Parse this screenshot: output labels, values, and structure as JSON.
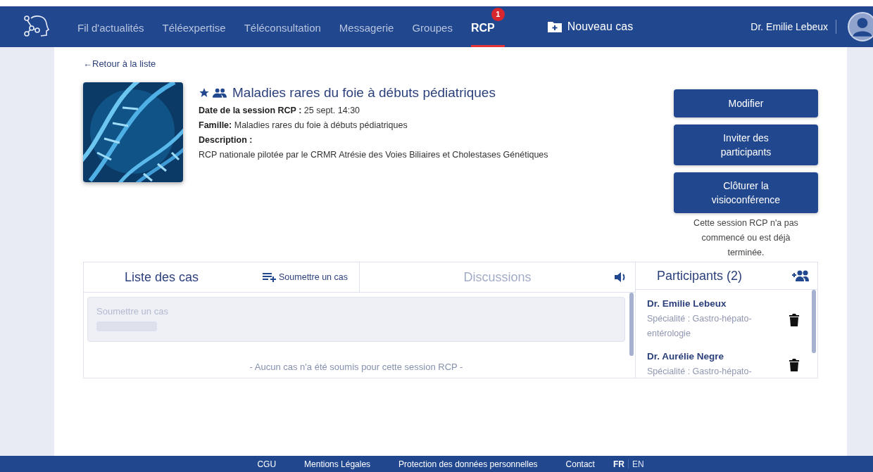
{
  "nav": {
    "items": [
      {
        "label": "Fil d'actualités",
        "selected": false
      },
      {
        "label": "Téléexpertise",
        "selected": false
      },
      {
        "label": "Téléconsultation",
        "selected": false
      },
      {
        "label": "Messagerie",
        "selected": false
      },
      {
        "label": "Groupes",
        "selected": false
      },
      {
        "label": "RCP",
        "selected": true,
        "badge": "1"
      }
    ],
    "new_case": "Nouveau cas",
    "user": "Dr. Emilie Lebeux"
  },
  "back_link": "←Retour à la liste",
  "session": {
    "favorite": true,
    "title": "Maladies rares du foie à débuts pédiatriques",
    "fields": [
      {
        "label": "Date de la session RCP :",
        "value": "25 sept. 14:30"
      },
      {
        "label": "Famille:",
        "value": "Maladies rares du foie à débuts pédiatriques"
      },
      {
        "label": "Description :"
      }
    ],
    "description": "RCP nationale pilotée par le CRMR Atrésie des Voies Biliaires et Cholestases Génétiques"
  },
  "actions": [
    "Modifier",
    "Inviter des participants",
    "Clôturer la visioconférence"
  ],
  "action_note": "Cette session RCP n'a pas commencé ou est déjà terminée.",
  "tabs": [
    {
      "label": "Liste des cas",
      "selected": true,
      "action": "Soumettre un cas"
    },
    {
      "label": "Discussions",
      "selected": false
    }
  ],
  "case_form": {
    "placeholder": "Soumettre un cas"
  },
  "empty_message": "- Aucun cas n'a été soumis pour cette session RCP -",
  "participants": {
    "title": "Participants (2)",
    "items": [
      {
        "name": "Dr. Emilie Lebeux",
        "specialty": "Spécialité : Gastro-hépato-entérologie"
      },
      {
        "name": "Dr. Aurélie Negre",
        "specialty": "Spécialité : Gastro-hépato-"
      }
    ]
  },
  "footer": {
    "links": [
      "CGU",
      "Mentions Légales",
      "Protection des données personnelles",
      "Contact"
    ],
    "languages": [
      {
        "label": "FR",
        "selected": true
      },
      {
        "label": "EN",
        "selected": false
      }
    ]
  }
}
